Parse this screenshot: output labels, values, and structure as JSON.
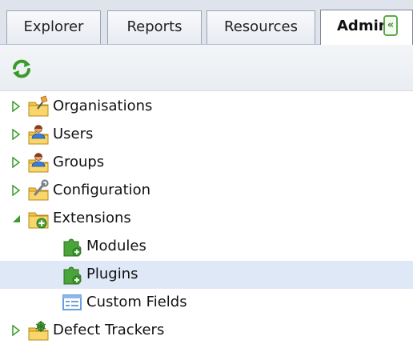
{
  "tabs": [
    {
      "label": "Explorer"
    },
    {
      "label": "Reports"
    },
    {
      "label": "Resources"
    },
    {
      "label": "Admin"
    }
  ],
  "tab_collapse_glyph": "«",
  "toolbar": {
    "refresh_icon": "refresh-icon"
  },
  "tree": {
    "organisations": "Organisations",
    "users": "Users",
    "groups": "Groups",
    "configuration": "Configuration",
    "extensions": "Extensions",
    "modules": "Modules",
    "plugins": "Plugins",
    "custom_fields": "Custom Fields",
    "defect_trackers": "Defect Trackers"
  },
  "colors": {
    "selected_row": "#dfe8f6",
    "expander_green": "#3c9b2e",
    "folder_yellow": "#f5c542",
    "puzzle_green": "#4aa43a"
  }
}
